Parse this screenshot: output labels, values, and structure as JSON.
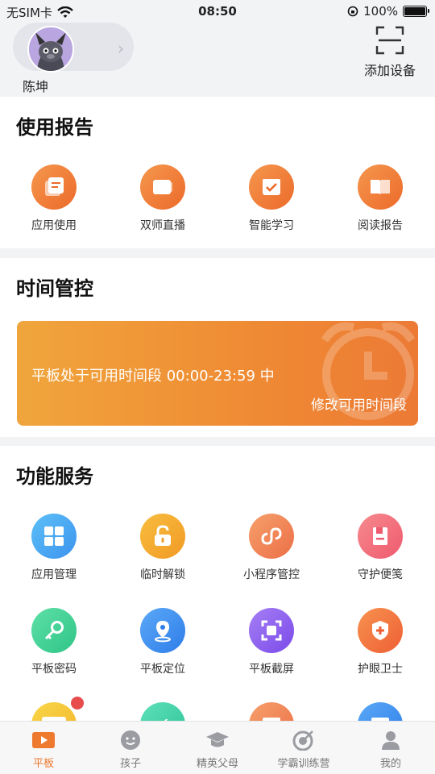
{
  "status_bar": {
    "carrier": "无SIM卡",
    "time": "08:50",
    "battery": "100%"
  },
  "profile": {
    "username": "陈坤"
  },
  "scan": {
    "label": "添加设备"
  },
  "usage_report": {
    "title": "使用报告",
    "items": [
      {
        "label": "应用使用",
        "icon": "app-usage-icon"
      },
      {
        "label": "双师直播",
        "icon": "live-class-icon"
      },
      {
        "label": "智能学习",
        "icon": "smart-learning-icon"
      },
      {
        "label": "阅读报告",
        "icon": "reading-report-icon"
      }
    ]
  },
  "time_control": {
    "title": "时间管控",
    "banner_text": "平板处于可用时间段 00:00-23:59 中",
    "modify_label": "修改可用时间段"
  },
  "services": {
    "title": "功能服务",
    "items": [
      {
        "label": "应用管理",
        "icon": "grid-icon",
        "color": "#4aa8f2"
      },
      {
        "label": "临时解锁",
        "icon": "unlock-icon",
        "color": "#f3a42f"
      },
      {
        "label": "小程序管控",
        "icon": "mini-program-icon",
        "color": "#f0855a"
      },
      {
        "label": "守护便笺",
        "icon": "note-icon",
        "color": "#f06b7a"
      },
      {
        "label": "平板密码",
        "icon": "key-icon",
        "color": "#3fcf94"
      },
      {
        "label": "平板定位",
        "icon": "location-icon",
        "color": "#3f8df3"
      },
      {
        "label": "平板截屏",
        "icon": "screenshot-icon",
        "color": "#8a5ff0"
      },
      {
        "label": "护眼卫士",
        "icon": "eye-guard-icon",
        "color": "#f0733e"
      }
    ]
  },
  "tabbar": {
    "items": [
      {
        "label": "平板",
        "icon": "tablet-play-icon",
        "active": true
      },
      {
        "label": "孩子",
        "icon": "child-face-icon",
        "active": false
      },
      {
        "label": "精英父母",
        "icon": "graduation-cap-icon",
        "active": false
      },
      {
        "label": "学霸训练营",
        "icon": "target-icon",
        "active": false
      },
      {
        "label": "我的",
        "icon": "person-icon",
        "active": false
      }
    ]
  },
  "colors": {
    "accent": "#ee7a2f",
    "page_bg": "#f2f3f5"
  }
}
